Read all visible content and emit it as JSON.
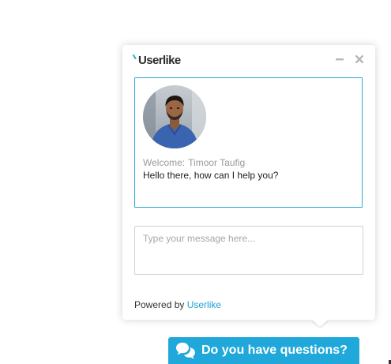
{
  "widget": {
    "brand": "Userlike",
    "minimize_icon": "minimize-icon",
    "close_icon": "close-icon",
    "operator": {
      "welcome_prefix": "Welcome:",
      "name": "Timoor Taufig"
    },
    "message": "Hello there, how can I help you?",
    "input": {
      "placeholder": "Type your message here...",
      "value": ""
    },
    "footer": {
      "powered_by_label": "Powered by",
      "powered_by_link": "Userlike"
    }
  },
  "cta": {
    "icon": "chat-bubbles-icon",
    "label": "Do you have questions?"
  },
  "colors": {
    "accent": "#1fa8d9",
    "border_active": "#29a9d6",
    "muted_text": "#9a9a9a"
  }
}
